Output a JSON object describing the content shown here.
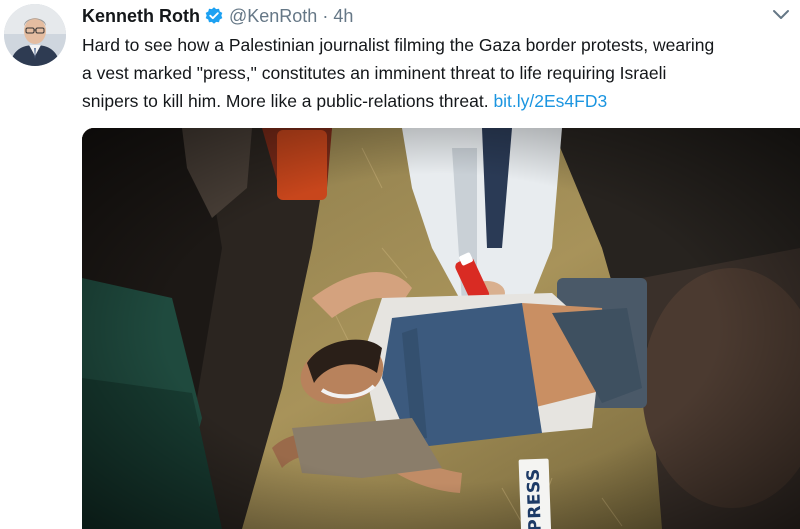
{
  "tweet": {
    "author": {
      "display_name": "Kenneth Roth",
      "handle": "@KenRoth",
      "verified_icon": "verified-badge-icon",
      "avatar_icon": "profile-photo"
    },
    "separator": "·",
    "timestamp": "4h",
    "menu_icon": "chevron-down-icon",
    "text_lines": [
      "Hard to see how a Palestinian journalist filming the Gaza border protests, wearing",
      "a vest marked \"press,\" constitutes an imminent threat to life requiring Israeli",
      "snipers to kill him. More like a public-relations threat."
    ],
    "link_text": "bit.ly/2Es4FD3",
    "media": {
      "vest_label": "PRESS"
    }
  },
  "colors": {
    "name": "#14171a",
    "secondary": "#657786",
    "link": "#1b95e0",
    "verified": "#1da1f2",
    "vest": "#3c5a7e"
  }
}
